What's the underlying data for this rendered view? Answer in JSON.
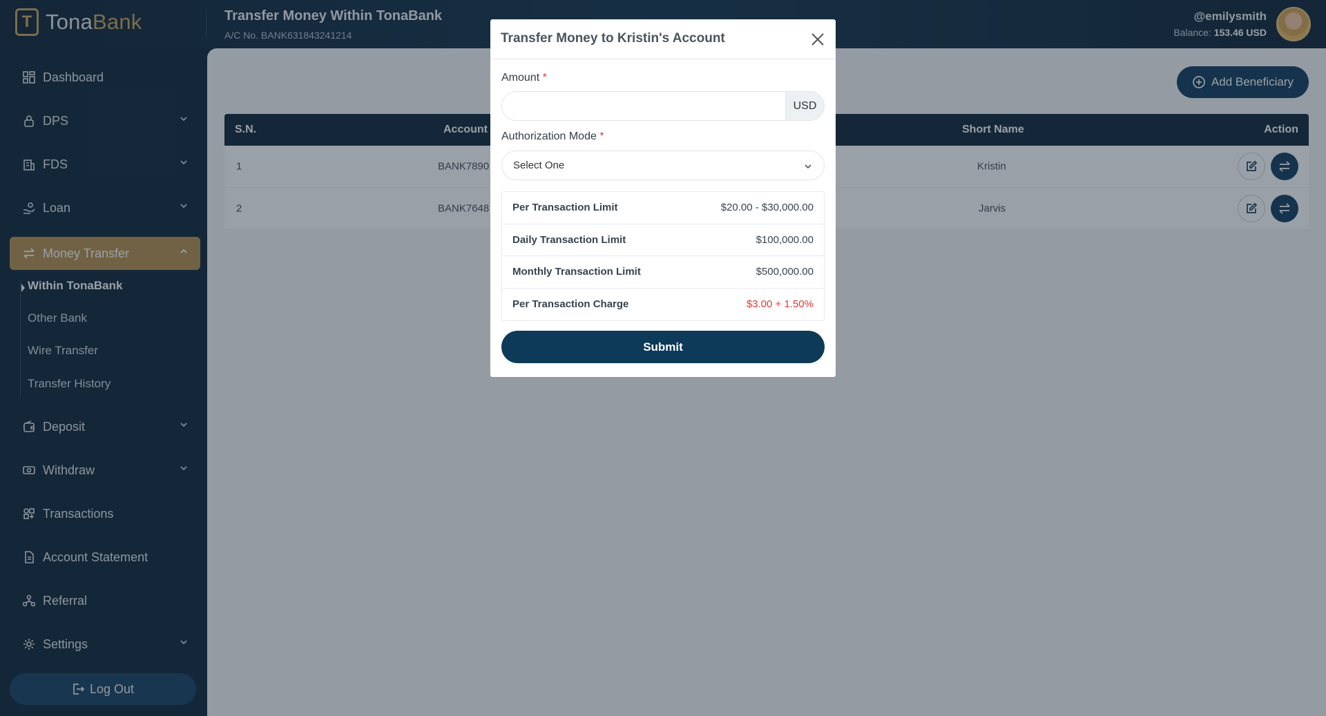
{
  "brand": {
    "name_part1": "Tona",
    "name_part2": "Bank",
    "mark": "T"
  },
  "header": {
    "title": "Transfer Money Within TonaBank",
    "account": "A/C No. BANK631843241214",
    "username": "@emilysmith",
    "balance_label": "Balance:",
    "balance_value": "153.46 USD"
  },
  "sidebar": {
    "items": [
      {
        "label": "Dashboard",
        "icon": "dashboard-icon"
      },
      {
        "label": "DPS",
        "icon": "lock-icon"
      },
      {
        "label": "FDS",
        "icon": "building-icon"
      },
      {
        "label": "Loan",
        "icon": "hand-coin-icon"
      },
      {
        "label": "Money Transfer",
        "icon": "transfer-icon"
      },
      {
        "label": "Deposit",
        "icon": "wallet-icon"
      },
      {
        "label": "Withdraw",
        "icon": "cash-icon"
      },
      {
        "label": "Transactions",
        "icon": "grid-icon"
      },
      {
        "label": "Account Statement",
        "icon": "document-icon"
      },
      {
        "label": "Referral",
        "icon": "network-icon"
      },
      {
        "label": "Settings",
        "icon": "gear-icon"
      }
    ],
    "money_transfer_sub": [
      "Within TonaBank",
      "Other Bank",
      "Wire Transfer",
      "Transfer History"
    ],
    "logout_label": "Log Out"
  },
  "main": {
    "add_beneficiary_label": "Add Beneficiary",
    "table": {
      "headers": {
        "sn": "S.N.",
        "account": "Account",
        "short_name": "Short Name",
        "action": "Action"
      },
      "rows": [
        {
          "sn": "1",
          "account": "BANK7890",
          "short_name": "Kristin"
        },
        {
          "sn": "2",
          "account": "BANK7648",
          "short_name": "Jarvis"
        }
      ]
    }
  },
  "modal": {
    "title": "Transfer Money to Kristin's Account",
    "amount_label": "Amount",
    "required_mark": "*",
    "amount_value": "",
    "amount_unit": "USD",
    "auth_label": "Authorization Mode",
    "auth_selected": "Select One",
    "limits": [
      {
        "label": "Per Transaction Limit",
        "value": "$20.00 - $30,000.00"
      },
      {
        "label": "Daily Transaction Limit",
        "value": "$100,000.00"
      },
      {
        "label": "Monthly Transaction Limit",
        "value": "$500,000.00"
      },
      {
        "label": "Per Transaction Charge",
        "value": "$3.00 + 1.50%"
      }
    ],
    "submit_label": "Submit"
  },
  "colors": {
    "accent_gold": "#b48f4d",
    "navy": "#0c2336",
    "button_blue": "#0e3a5a",
    "charge_red": "#e53935"
  }
}
